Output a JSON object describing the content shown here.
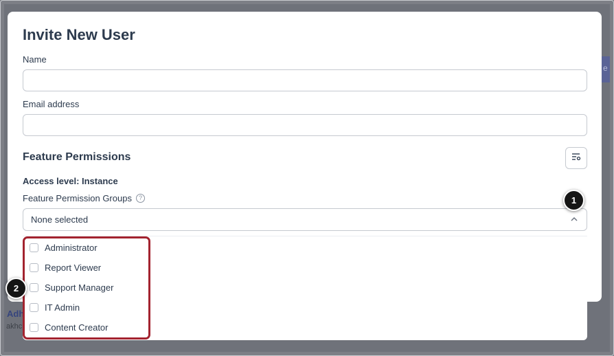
{
  "modal": {
    "title": "Invite New User",
    "name_label": "Name",
    "name_value": "",
    "email_label": "Email address",
    "email_value": "",
    "section_title": "Feature Permissions",
    "access_level": "Access level: Instance",
    "groups_label": "Feature Permission Groups",
    "select_value": "None selected"
  },
  "dropdown": {
    "options": [
      {
        "label": "Administrator",
        "checked": false
      },
      {
        "label": "Report Viewer",
        "checked": false
      },
      {
        "label": "Support Manager",
        "checked": false
      },
      {
        "label": "IT Admin",
        "checked": false
      },
      {
        "label": "Content Creator",
        "checked": false
      }
    ]
  },
  "callouts": {
    "one": "1",
    "two": "2"
  },
  "background": {
    "link_text": "Adh",
    "sub_text": "akhc"
  },
  "colors": {
    "highlight": "#a3232f",
    "overlay": "#7d7f86",
    "text": "#2d3b4e"
  }
}
